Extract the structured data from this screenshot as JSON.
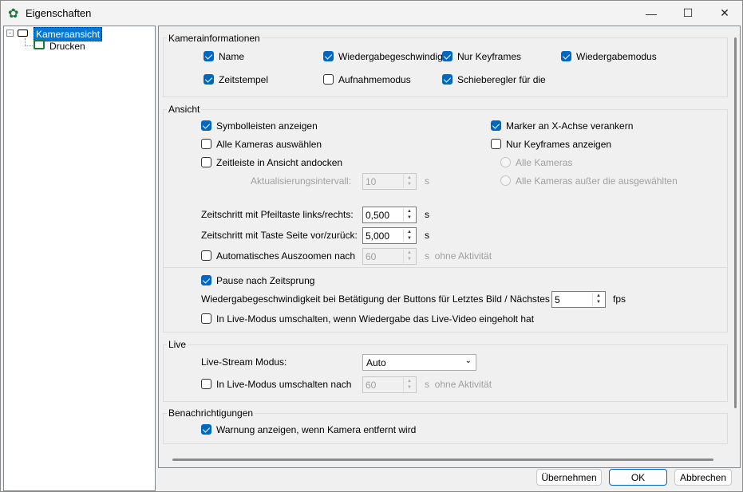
{
  "window": {
    "title": "Eigenschaften",
    "minimize": "—",
    "maximize": "☐",
    "close": "✕"
  },
  "tree": {
    "items": [
      {
        "label": "Kameraansicht"
      },
      {
        "label": "Drucken"
      }
    ]
  },
  "kamerainfo": {
    "legend": "Kamerainformationen",
    "items": [
      {
        "label": "Name",
        "checked": true
      },
      {
        "label": "Zeitstempel",
        "checked": true
      },
      {
        "label": "Wiedergabegeschwindig",
        "checked": true
      },
      {
        "label": "Aufnahmemodus",
        "checked": false
      },
      {
        "label": "Nur Keyframes",
        "checked": true
      },
      {
        "label": "Schieberegler für die",
        "checked": true
      },
      {
        "label": "Wiedergabemodus",
        "checked": true
      }
    ]
  },
  "ansicht": {
    "legend": "Ansicht",
    "symbolleisten": "Symbolleisten anzeigen",
    "alle_kameras": "Alle Kameras auswählen",
    "zeitleiste": "Zeitleiste in Ansicht andocken",
    "marker": "Marker an X-Achse verankern",
    "nur_keyframes": "Nur Keyframes anzeigen",
    "radio1": "Alle Kameras",
    "radio2": "Alle Kameras außer die ausgewählten",
    "intervall_label": "Aktualisierungsintervall:",
    "intervall_value": "10",
    "unit_s": "s",
    "pfeil_label": "Zeitschritt mit Pfeiltaste links/rechts:",
    "pfeil_value": "0,500",
    "seite_label": "Zeitschritt mit Taste Seite vor/zurück:",
    "seite_value": "5,000",
    "auszoomen_label": "Automatisches Auszoomen nach",
    "auszoomen_value": "60",
    "ohne": "s  ohne Aktivität",
    "pause": "Pause nach Zeitsprung",
    "speed_label": "Wiedergabegeschwindigkeit bei Betätigung der Buttons für Letztes Bild / Nächstes Bild",
    "speed_value": "5",
    "fps": "fps",
    "live_switch": "In Live-Modus umschalten, wenn Wiedergabe das Live-Video eingeholt hat"
  },
  "live": {
    "legend": "Live",
    "mode_label": "Live-Stream Modus:",
    "mode_value": "Auto",
    "switch_label": "In Live-Modus umschalten nach",
    "switch_value": "60",
    "ohne": "s  ohne Aktivität"
  },
  "notify": {
    "legend": "Benachrichtigungen",
    "warn": "Warnung anzeigen, wenn Kamera entfernt wird"
  },
  "buttons": {
    "apply": "Übernehmen",
    "ok": "OK",
    "cancel": "Abbrechen"
  }
}
